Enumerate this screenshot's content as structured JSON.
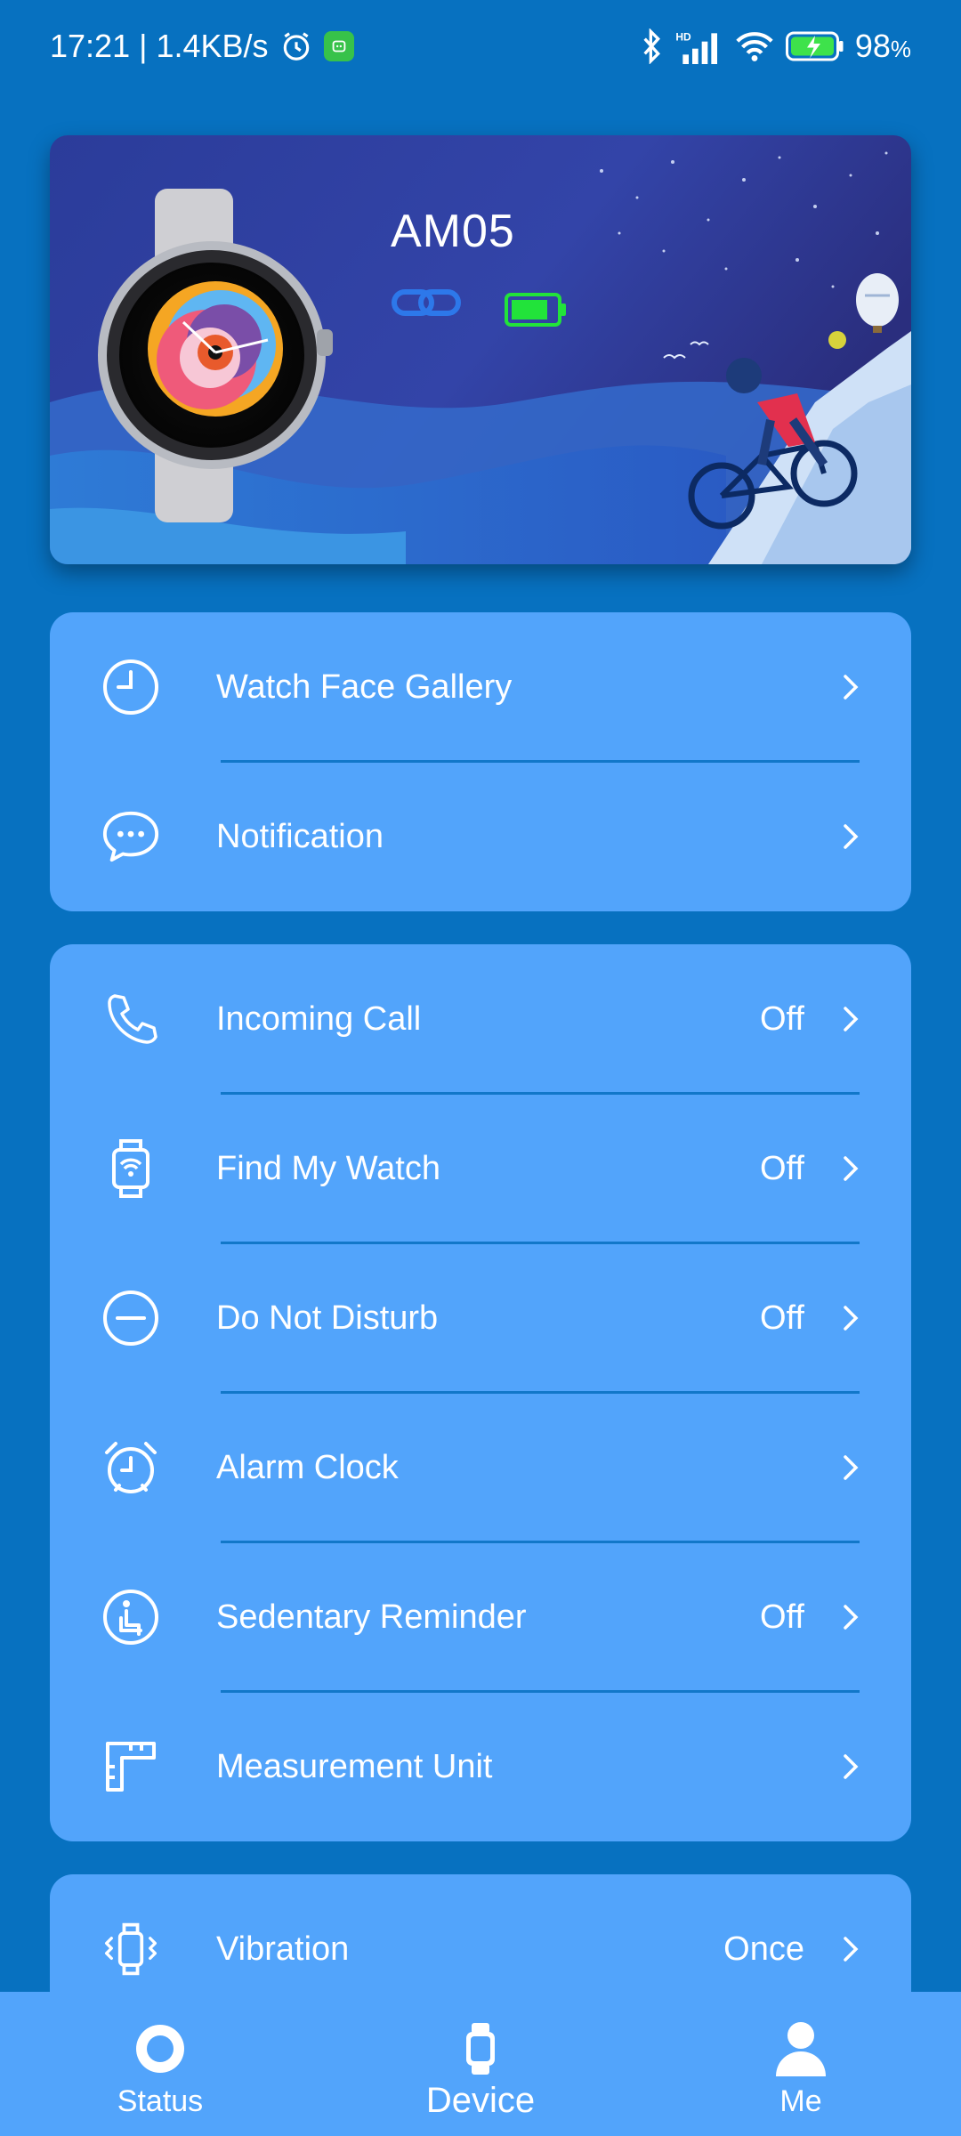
{
  "status_bar": {
    "time_speed": "17:21 | 1.4KB/s",
    "battery_percent": "98",
    "battery_unit": "%"
  },
  "device": {
    "name": "AM05",
    "connection_icon": "link-icon",
    "battery_icon": "battery-icon",
    "battery_color": "#22e33a"
  },
  "card1": {
    "items": [
      {
        "label": "Watch Face Gallery",
        "value": "",
        "icon": "clock-icon"
      },
      {
        "label": "Notification",
        "value": "",
        "icon": "chat-bubble-icon"
      }
    ]
  },
  "card2": {
    "items": [
      {
        "label": "Incoming Call",
        "value": "Off",
        "icon": "phone-icon"
      },
      {
        "label": "Find My Watch",
        "value": "Off",
        "icon": "watch-signal-icon"
      },
      {
        "label": "Do Not Disturb",
        "value": "Off",
        "icon": "minus-circle-icon"
      },
      {
        "label": "Alarm Clock",
        "value": "",
        "icon": "alarm-clock-icon"
      },
      {
        "label": "Sedentary Reminder",
        "value": "Off",
        "icon": "sitting-person-icon"
      },
      {
        "label": "Measurement Unit",
        "value": "",
        "icon": "ruler-icon"
      }
    ]
  },
  "card3": {
    "items": [
      {
        "label": "Vibration",
        "value": "Once",
        "icon": "vibration-icon"
      }
    ]
  },
  "bottom_nav": {
    "items": [
      {
        "label": "Status",
        "icon": "ring-icon"
      },
      {
        "label": "Device",
        "icon": "watch-icon",
        "active": true
      },
      {
        "label": "Me",
        "icon": "person-icon"
      }
    ]
  },
  "colors": {
    "background": "#0771c0",
    "card": "#52a4fb",
    "divider": "#1177c9"
  }
}
